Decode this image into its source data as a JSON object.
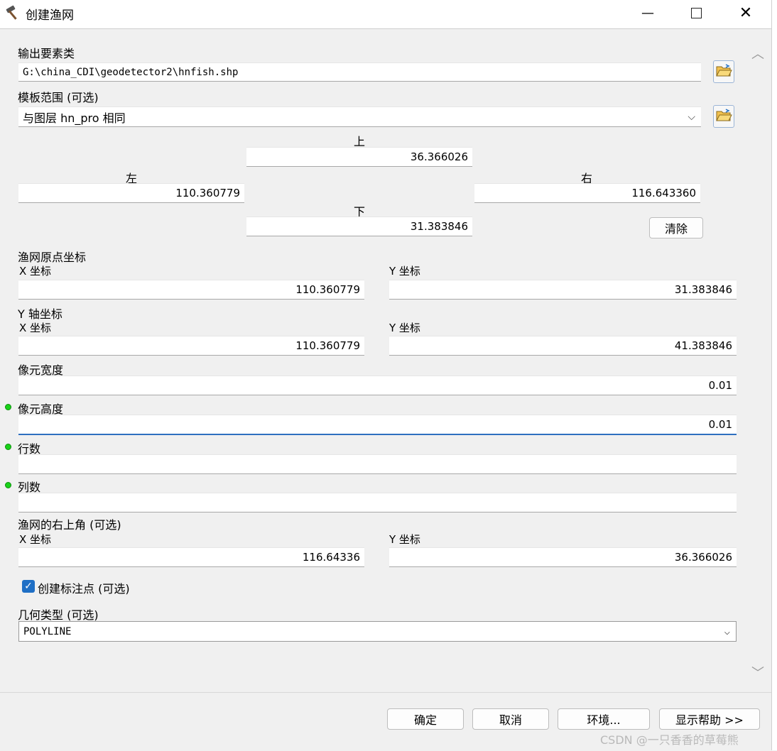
{
  "window": {
    "title": "创建渔网"
  },
  "output_features": {
    "label": "输出要素类",
    "value": "G:\\china_CDI\\geodetector2\\hnfish.shp"
  },
  "template_extent": {
    "label": "模板范围 (可选)",
    "selected": "与图层 hn_pro 相同",
    "top_label": "上",
    "top": "36.366026",
    "left_label": "左",
    "left": "110.360779",
    "right_label": "右",
    "right": "116.643360",
    "bottom_label": "下",
    "bottom": "31.383846",
    "clear_label": "清除"
  },
  "origin": {
    "label": "渔网原点坐标",
    "x_label": "X 坐标",
    "x": "110.360779",
    "y_label": "Y 坐标",
    "y": "31.383846"
  },
  "y_axis": {
    "label": "Y 轴坐标",
    "x_label": "X 坐标",
    "x": "110.360779",
    "y_label": "Y 坐标",
    "y": "41.383846"
  },
  "cell_width": {
    "label": "像元宽度",
    "value": "0.01"
  },
  "cell_height": {
    "label": "像元高度",
    "value": "0.01"
  },
  "rows": {
    "label": "行数",
    "value": ""
  },
  "columns": {
    "label": "列数",
    "value": ""
  },
  "opposite_corner": {
    "label": "渔网的右上角 (可选)",
    "x_label": "X 坐标",
    "x": "116.64336",
    "y_label": "Y 坐标",
    "y": "36.366026"
  },
  "label_points": {
    "label": "创建标注点 (可选)",
    "checked": true
  },
  "geometry_type": {
    "label": "几何类型 (可选)",
    "selected": "POLYLINE"
  },
  "buttons": {
    "ok": "确定",
    "cancel": "取消",
    "environments": "环境...",
    "help": "显示帮助 >>"
  },
  "watermark": "CSDN @一只香香的草莓熊",
  "colors": {
    "accent": "#1f6fc5",
    "required_dot": "#1ad21a"
  }
}
